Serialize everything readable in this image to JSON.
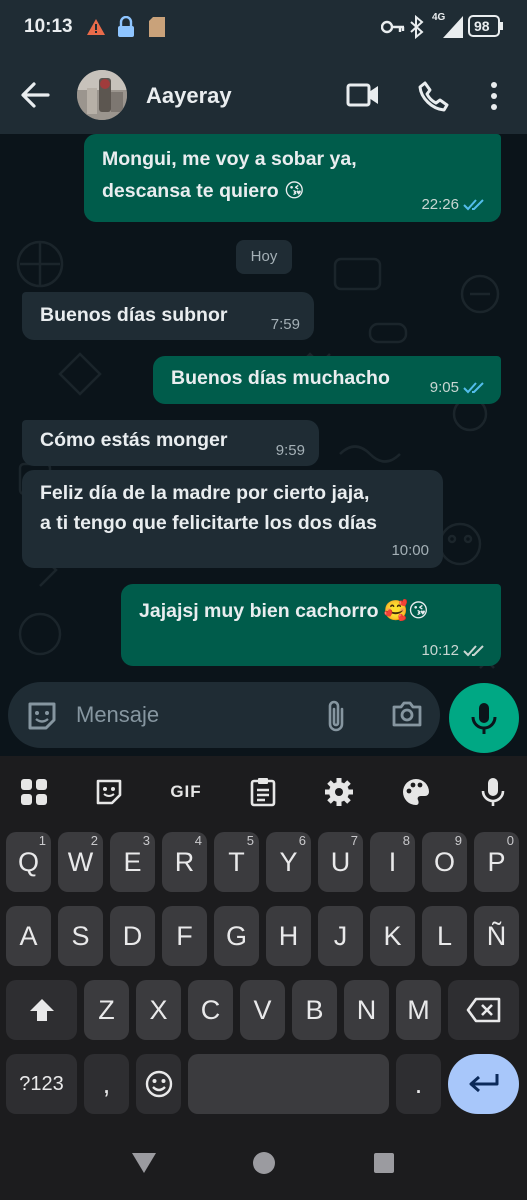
{
  "status_bar": {
    "time": "10:13",
    "battery": "98",
    "network": "4G",
    "icons": [
      "alert-triangle-icon",
      "lock-icon",
      "sd-card-icon",
      "key-icon",
      "bluetooth-icon",
      "signal-icon",
      "battery-icon"
    ]
  },
  "header": {
    "contact_name": "Aayeray",
    "icons": [
      "back-arrow-icon",
      "video-call-icon",
      "phone-icon",
      "more-vert-icon"
    ]
  },
  "chat": {
    "date_chip": "Hoy",
    "messages": [
      {
        "direction": "out",
        "lines": [
          "Mongui, me voy a sobar ya,",
          "descansa te quiero 😘"
        ],
        "time": "22:26",
        "status": "read"
      },
      {
        "direction": "in",
        "lines": [
          "Buenos días subnor"
        ],
        "time": "7:59"
      },
      {
        "direction": "out",
        "lines": [
          "Buenos días muchacho"
        ],
        "time": "9:05",
        "status": "read"
      },
      {
        "direction": "in",
        "lines": [
          "Cómo estás monger"
        ],
        "time": "9:59"
      },
      {
        "direction": "in",
        "lines": [
          "Feliz día de la madre por cierto jaja,",
          "a ti tengo que felicitarte los dos días"
        ],
        "time": "10:00"
      },
      {
        "direction": "out",
        "lines": [
          "Jajajsj muy bien cachorro 🥰😘"
        ],
        "time": "10:12",
        "status": "delivered"
      }
    ]
  },
  "composer": {
    "placeholder": "Mensaje",
    "icons": [
      "sticker-icon",
      "attach-icon",
      "camera-icon",
      "mic-icon"
    ]
  },
  "keyboard": {
    "toolbar": {
      "gif_label": "GIF",
      "icons": [
        "apps-grid-icon",
        "sticker-icon",
        "gif-icon",
        "clipboard-icon",
        "settings-icon",
        "palette-icon",
        "voice-input-icon"
      ]
    },
    "row1": [
      "Q",
      "W",
      "E",
      "R",
      "T",
      "Y",
      "U",
      "I",
      "O",
      "P"
    ],
    "row1_hints": [
      "1",
      "2",
      "3",
      "4",
      "5",
      "6",
      "7",
      "8",
      "9",
      "0"
    ],
    "row2": [
      "A",
      "S",
      "D",
      "F",
      "G",
      "H",
      "J",
      "K",
      "L",
      "Ñ"
    ],
    "row3": [
      "Z",
      "X",
      "C",
      "V",
      "B",
      "N",
      "M"
    ],
    "symbols_label": "?123",
    "comma": ",",
    "period": "."
  },
  "colors": {
    "outgoing_bubble": "#005c4b",
    "incoming_bubble": "#1f2c34",
    "chat_background": "#0b141a",
    "accent": "#00a884",
    "read_ticks": "#53bdeb",
    "enter_key": "#a8c7fa"
  }
}
